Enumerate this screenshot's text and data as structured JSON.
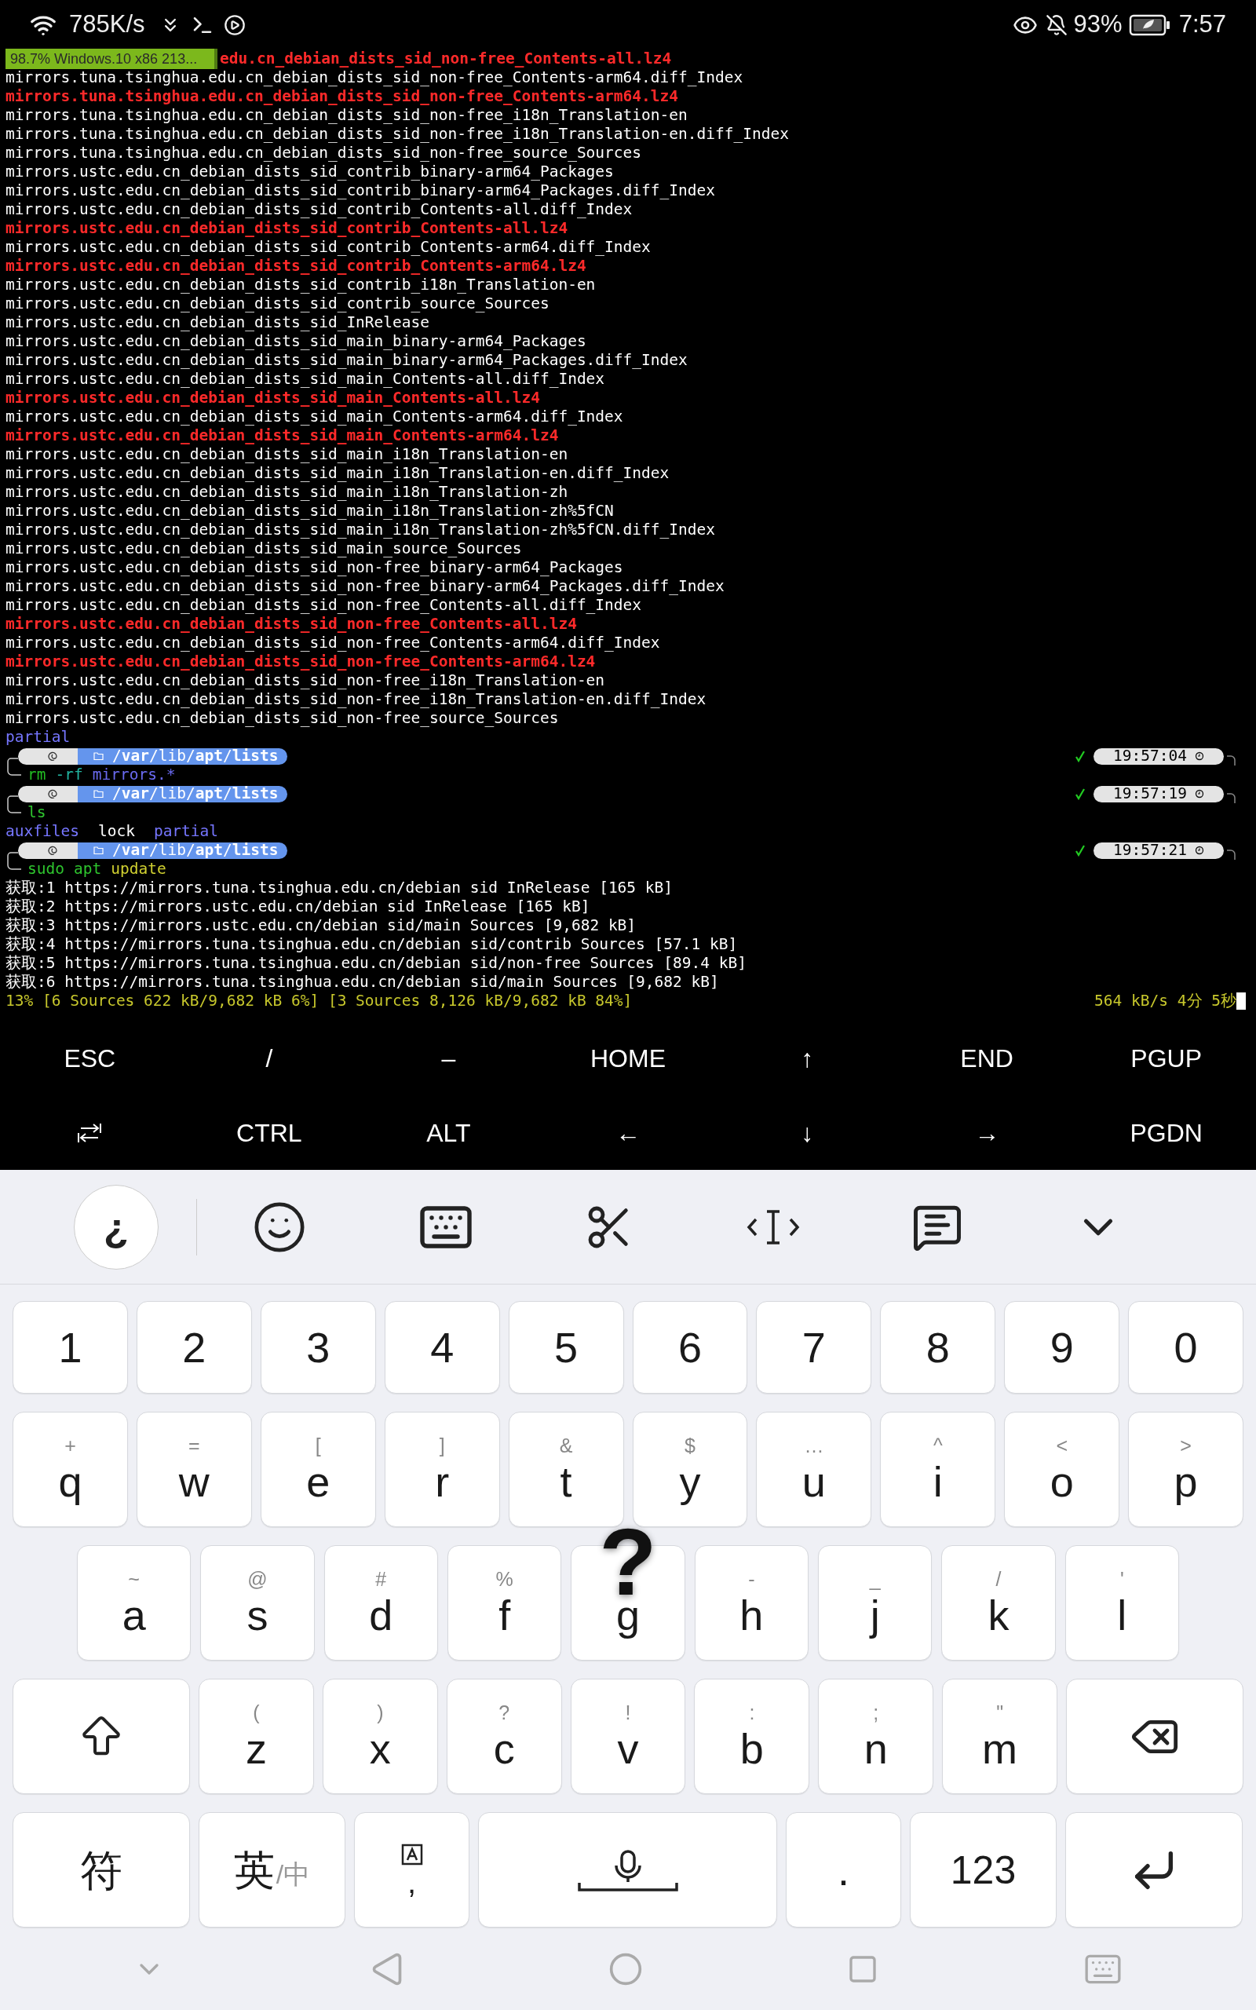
{
  "status_bar": {
    "speed": "785K/s",
    "battery": "93%",
    "time": "7:57"
  },
  "download_toast": {
    "text": "98.7% Windows.10 x86 213...",
    "level": 0.987
  },
  "terminal": {
    "lines": [
      {
        "kind": "out",
        "text": "edu.cn_debian_dists_sid_non-free_Contents-all.lz4",
        "color": "#ff2a2a",
        "bold": true
      },
      {
        "kind": "out",
        "text": "mirrors.tuna.tsinghua.edu.cn_debian_dists_sid_non-free_Contents-arm64.diff_Index",
        "color": "#ffffff",
        "bold": false
      },
      {
        "kind": "out",
        "text": "mirrors.tuna.tsinghua.edu.cn_debian_dists_sid_non-free_Contents-arm64.lz4",
        "color": "#ff2a2a",
        "bold": true
      },
      {
        "kind": "out",
        "text": "mirrors.tuna.tsinghua.edu.cn_debian_dists_sid_non-free_i18n_Translation-en",
        "color": "#ffffff",
        "bold": false
      },
      {
        "kind": "out",
        "text": "mirrors.tuna.tsinghua.edu.cn_debian_dists_sid_non-free_i18n_Translation-en.diff_Index",
        "color": "#ffffff",
        "bold": false
      },
      {
        "kind": "out",
        "text": "mirrors.tuna.tsinghua.edu.cn_debian_dists_sid_non-free_source_Sources",
        "color": "#ffffff",
        "bold": false
      },
      {
        "kind": "out",
        "text": "mirrors.ustc.edu.cn_debian_dists_sid_contrib_binary-arm64_Packages",
        "color": "#ffffff",
        "bold": false
      },
      {
        "kind": "out",
        "text": "mirrors.ustc.edu.cn_debian_dists_sid_contrib_binary-arm64_Packages.diff_Index",
        "color": "#ffffff",
        "bold": false
      },
      {
        "kind": "out",
        "text": "mirrors.ustc.edu.cn_debian_dists_sid_contrib_Contents-all.diff_Index",
        "color": "#ffffff",
        "bold": false
      },
      {
        "kind": "out",
        "text": "mirrors.ustc.edu.cn_debian_dists_sid_contrib_Contents-all.lz4",
        "color": "#ff2a2a",
        "bold": true
      },
      {
        "kind": "out",
        "text": "mirrors.ustc.edu.cn_debian_dists_sid_contrib_Contents-arm64.diff_Index",
        "color": "#ffffff",
        "bold": false
      },
      {
        "kind": "out",
        "text": "mirrors.ustc.edu.cn_debian_dists_sid_contrib_Contents-arm64.lz4",
        "color": "#ff2a2a",
        "bold": true
      },
      {
        "kind": "out",
        "text": "mirrors.ustc.edu.cn_debian_dists_sid_contrib_i18n_Translation-en",
        "color": "#ffffff",
        "bold": false
      },
      {
        "kind": "out",
        "text": "mirrors.ustc.edu.cn_debian_dists_sid_contrib_source_Sources",
        "color": "#ffffff",
        "bold": false
      },
      {
        "kind": "out",
        "text": "mirrors.ustc.edu.cn_debian_dists_sid_InRelease",
        "color": "#ffffff",
        "bold": false
      },
      {
        "kind": "out",
        "text": "mirrors.ustc.edu.cn_debian_dists_sid_main_binary-arm64_Packages",
        "color": "#ffffff",
        "bold": false
      },
      {
        "kind": "out",
        "text": "mirrors.ustc.edu.cn_debian_dists_sid_main_binary-arm64_Packages.diff_Index",
        "color": "#ffffff",
        "bold": false
      },
      {
        "kind": "out",
        "text": "mirrors.ustc.edu.cn_debian_dists_sid_main_Contents-all.diff_Index",
        "color": "#ffffff",
        "bold": false
      },
      {
        "kind": "out",
        "text": "mirrors.ustc.edu.cn_debian_dists_sid_main_Contents-all.lz4",
        "color": "#ff2a2a",
        "bold": true
      },
      {
        "kind": "out",
        "text": "mirrors.ustc.edu.cn_debian_dists_sid_main_Contents-arm64.diff_Index",
        "color": "#ffffff",
        "bold": false
      },
      {
        "kind": "out",
        "text": "mirrors.ustc.edu.cn_debian_dists_sid_main_Contents-arm64.lz4",
        "color": "#ff2a2a",
        "bold": true
      },
      {
        "kind": "out",
        "text": "mirrors.ustc.edu.cn_debian_dists_sid_main_i18n_Translation-en",
        "color": "#ffffff",
        "bold": false
      },
      {
        "kind": "out",
        "text": "mirrors.ustc.edu.cn_debian_dists_sid_main_i18n_Translation-en.diff_Index",
        "color": "#ffffff",
        "bold": false
      },
      {
        "kind": "out",
        "text": "mirrors.ustc.edu.cn_debian_dists_sid_main_i18n_Translation-zh",
        "color": "#ffffff",
        "bold": false
      },
      {
        "kind": "out",
        "text": "mirrors.ustc.edu.cn_debian_dists_sid_main_i18n_Translation-zh%5fCN",
        "color": "#ffffff",
        "bold": false
      },
      {
        "kind": "out",
        "text": "mirrors.ustc.edu.cn_debian_dists_sid_main_i18n_Translation-zh%5fCN.diff_Index",
        "color": "#ffffff",
        "bold": false
      },
      {
        "kind": "out",
        "text": "mirrors.ustc.edu.cn_debian_dists_sid_main_source_Sources",
        "color": "#ffffff",
        "bold": false
      },
      {
        "kind": "out",
        "text": "mirrors.ustc.edu.cn_debian_dists_sid_non-free_binary-arm64_Packages",
        "color": "#ffffff",
        "bold": false
      },
      {
        "kind": "out",
        "text": "mirrors.ustc.edu.cn_debian_dists_sid_non-free_binary-arm64_Packages.diff_Index",
        "color": "#ffffff",
        "bold": false
      },
      {
        "kind": "out",
        "text": "mirrors.ustc.edu.cn_debian_dists_sid_non-free_Contents-all.diff_Index",
        "color": "#ffffff",
        "bold": false
      },
      {
        "kind": "out",
        "text": "mirrors.ustc.edu.cn_debian_dists_sid_non-free_Contents-all.lz4",
        "color": "#ff2a2a",
        "bold": true
      },
      {
        "kind": "out",
        "text": "mirrors.ustc.edu.cn_debian_dists_sid_non-free_Contents-arm64.diff_Index",
        "color": "#ffffff",
        "bold": false
      },
      {
        "kind": "out",
        "text": "mirrors.ustc.edu.cn_debian_dists_sid_non-free_Contents-arm64.lz4",
        "color": "#ff2a2a",
        "bold": true
      },
      {
        "kind": "out",
        "text": "mirrors.ustc.edu.cn_debian_dists_sid_non-free_i18n_Translation-en",
        "color": "#ffffff",
        "bold": false
      },
      {
        "kind": "out",
        "text": "mirrors.ustc.edu.cn_debian_dists_sid_non-free_i18n_Translation-en.diff_Index",
        "color": "#ffffff",
        "bold": false
      },
      {
        "kind": "out",
        "text": "mirrors.ustc.edu.cn_debian_dists_sid_non-free_source_Sources",
        "color": "#ffffff",
        "bold": false
      },
      {
        "kind": "out",
        "text": "partial",
        "color": "#7676ff",
        "bold": false
      },
      {
        "kind": "prompt",
        "path": "/**var**/lib/**apt**/**lists**",
        "ok": true,
        "time": "19:57:04"
      },
      {
        "kind": "cmd",
        "tokens": [
          {
            "text": "rm",
            "color": "#22bb22"
          },
          {
            "text": "-rf",
            "color": "#22b4a0"
          },
          {
            "text": "mirrors.*",
            "color": "#6a6af0"
          }
        ]
      },
      {
        "kind": "prompt",
        "path": "/**var**/lib/**apt**/**lists**",
        "ok": true,
        "time": "19:57:19"
      },
      {
        "kind": "cmd",
        "tokens": [
          {
            "text": "ls",
            "color": "#2ec42e"
          }
        ]
      },
      {
        "kind": "files",
        "items": [
          {
            "text": "auxfiles",
            "color": "#7676ff"
          },
          {
            "text": "lock",
            "color": "#ffffff"
          },
          {
            "text": "partial",
            "color": "#7676ff"
          }
        ]
      },
      {
        "kind": "prompt",
        "path": "/**var**/lib/**apt**/**lists**",
        "ok": true,
        "time": "19:57:21"
      },
      {
        "kind": "cmd",
        "tokens": [
          {
            "text": "sudo",
            "color": "#2ec42e"
          },
          {
            "text": "apt",
            "color": "#2ec42e"
          },
          {
            "text": "update",
            "color": "#d0d030"
          }
        ]
      },
      {
        "kind": "out",
        "text": "获取:1 https://mirrors.tuna.tsinghua.edu.cn/debian sid InRelease [165 kB]",
        "color": "#ffffff",
        "bold": false
      },
      {
        "kind": "out",
        "text": "获取:2 https://mirrors.ustc.edu.cn/debian sid InRelease [165 kB]",
        "color": "#ffffff",
        "bold": false
      },
      {
        "kind": "out",
        "text": "获取:3 https://mirrors.ustc.edu.cn/debian sid/main Sources [9,682 kB]",
        "color": "#ffffff",
        "bold": false
      },
      {
        "kind": "out",
        "text": "获取:4 https://mirrors.tuna.tsinghua.edu.cn/debian sid/contrib Sources [57.1 kB]",
        "color": "#ffffff",
        "bold": false
      },
      {
        "kind": "out",
        "text": "获取:5 https://mirrors.tuna.tsinghua.edu.cn/debian sid/non-free Sources [89.4 kB]",
        "color": "#ffffff",
        "bold": false
      },
      {
        "kind": "out",
        "text": "获取:6 https://mirrors.tuna.tsinghua.edu.cn/debian sid/main Sources [9,682 kB]",
        "color": "#ffffff",
        "bold": false
      },
      {
        "kind": "progress",
        "left": "13% [6 Sources 622 kB/9,682 kB 6%] [3 Sources 8,126 kB/9,682 kB 84%]",
        "right": "564 kB/s 4分 5秒"
      }
    ]
  },
  "extra_keys": [
    [
      {
        "kind": "text",
        "label": "ESC"
      },
      {
        "kind": "text",
        "label": "/"
      },
      {
        "kind": "text",
        "label": "–"
      },
      {
        "kind": "text",
        "label": "HOME"
      },
      {
        "kind": "text",
        "label": "↑"
      },
      {
        "kind": "text",
        "label": "END"
      },
      {
        "kind": "text",
        "label": "PGUP"
      }
    ],
    [
      {
        "kind": "tab"
      },
      {
        "kind": "text",
        "label": "CTRL"
      },
      {
        "kind": "text",
        "label": "ALT"
      },
      {
        "kind": "text",
        "label": "←"
      },
      {
        "kind": "text",
        "label": "↓"
      },
      {
        "kind": "text",
        "label": "→"
      },
      {
        "kind": "text",
        "label": "PGDN"
      }
    ]
  ],
  "keyboard": {
    "toolbar": {
      "symbol": "¿"
    },
    "rows": [
      [
        {
          "kind": "char",
          "main": "1"
        },
        {
          "kind": "char",
          "main": "2"
        },
        {
          "kind": "char",
          "main": "3"
        },
        {
          "kind": "char",
          "main": "4"
        },
        {
          "kind": "char",
          "main": "5"
        },
        {
          "kind": "char",
          "main": "6"
        },
        {
          "kind": "char",
          "main": "7"
        },
        {
          "kind": "char",
          "main": "8"
        },
        {
          "kind": "char",
          "main": "9"
        },
        {
          "kind": "char",
          "main": "0"
        }
      ],
      [
        {
          "kind": "char",
          "main": "q",
          "hint": "+"
        },
        {
          "kind": "char",
          "main": "w",
          "hint": "="
        },
        {
          "kind": "char",
          "main": "e",
          "hint": "["
        },
        {
          "kind": "char",
          "main": "r",
          "hint": "]"
        },
        {
          "kind": "char",
          "main": "t",
          "hint": "&"
        },
        {
          "kind": "char",
          "main": "y",
          "hint": "$"
        },
        {
          "kind": "char",
          "main": "u",
          "hint": "…"
        },
        {
          "kind": "char",
          "main": "i",
          "hint": "^"
        },
        {
          "kind": "char",
          "main": "o",
          "hint": "<"
        },
        {
          "kind": "char",
          "main": "p",
          "hint": ">"
        }
      ],
      [
        {
          "kind": "char",
          "main": "a",
          "hint": "~"
        },
        {
          "kind": "char",
          "main": "s",
          "hint": "@"
        },
        {
          "kind": "char",
          "main": "d",
          "hint": "#"
        },
        {
          "kind": "char",
          "main": "f",
          "hint": "%"
        },
        {
          "kind": "char",
          "main": "g",
          "popup": "?"
        },
        {
          "kind": "char",
          "main": "h",
          "hint": "-"
        },
        {
          "kind": "char",
          "main": "j",
          "hint": "_"
        },
        {
          "kind": "char",
          "main": "k",
          "hint": "/"
        },
        {
          "kind": "char",
          "main": "l",
          "hint": "'"
        }
      ],
      [
        {
          "kind": "shift"
        },
        {
          "kind": "char",
          "main": "z",
          "hint": "("
        },
        {
          "kind": "char",
          "main": "x",
          "hint": ")"
        },
        {
          "kind": "char",
          "main": "c",
          "hint": "?"
        },
        {
          "kind": "char",
          "main": "v",
          "hint": "!"
        },
        {
          "kind": "char",
          "main": "b",
          "hint": ":"
        },
        {
          "kind": "char",
          "main": "n",
          "hint": ";"
        },
        {
          "kind": "char",
          "main": "m",
          "hint": "\""
        },
        {
          "kind": "backspace"
        }
      ],
      [
        {
          "kind": "char",
          "main": "符"
        },
        {
          "kind": "lang",
          "main": "英",
          "hint": "/中"
        },
        {
          "kind": "comma",
          "main": ","
        },
        {
          "kind": "space"
        },
        {
          "kind": "char",
          "main": "."
        },
        {
          "kind": "char",
          "main": "123"
        },
        {
          "kind": "enter"
        }
      ]
    ]
  }
}
